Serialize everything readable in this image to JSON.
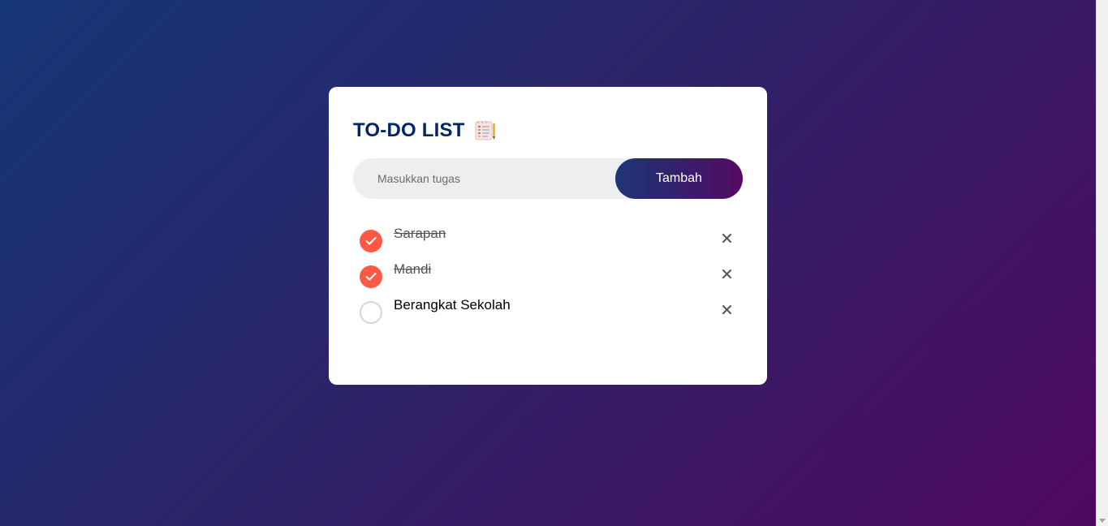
{
  "app": {
    "title": "TO-DO LIST",
    "title_icon": "memo-list-icon"
  },
  "input": {
    "placeholder": "Masukkan tugas",
    "value": ""
  },
  "add_button": {
    "label": "Tambah"
  },
  "tasks": [
    {
      "text": "Sarapan",
      "done": true
    },
    {
      "text": "Mandi",
      "done": true
    },
    {
      "text": "Berangkat Sekolah",
      "done": false
    }
  ],
  "colors": {
    "accent": "#ff5945",
    "title": "#002765",
    "gradient_start": "#153677",
    "gradient_end": "#4e085f",
    "input_bg": "#edeef0"
  }
}
